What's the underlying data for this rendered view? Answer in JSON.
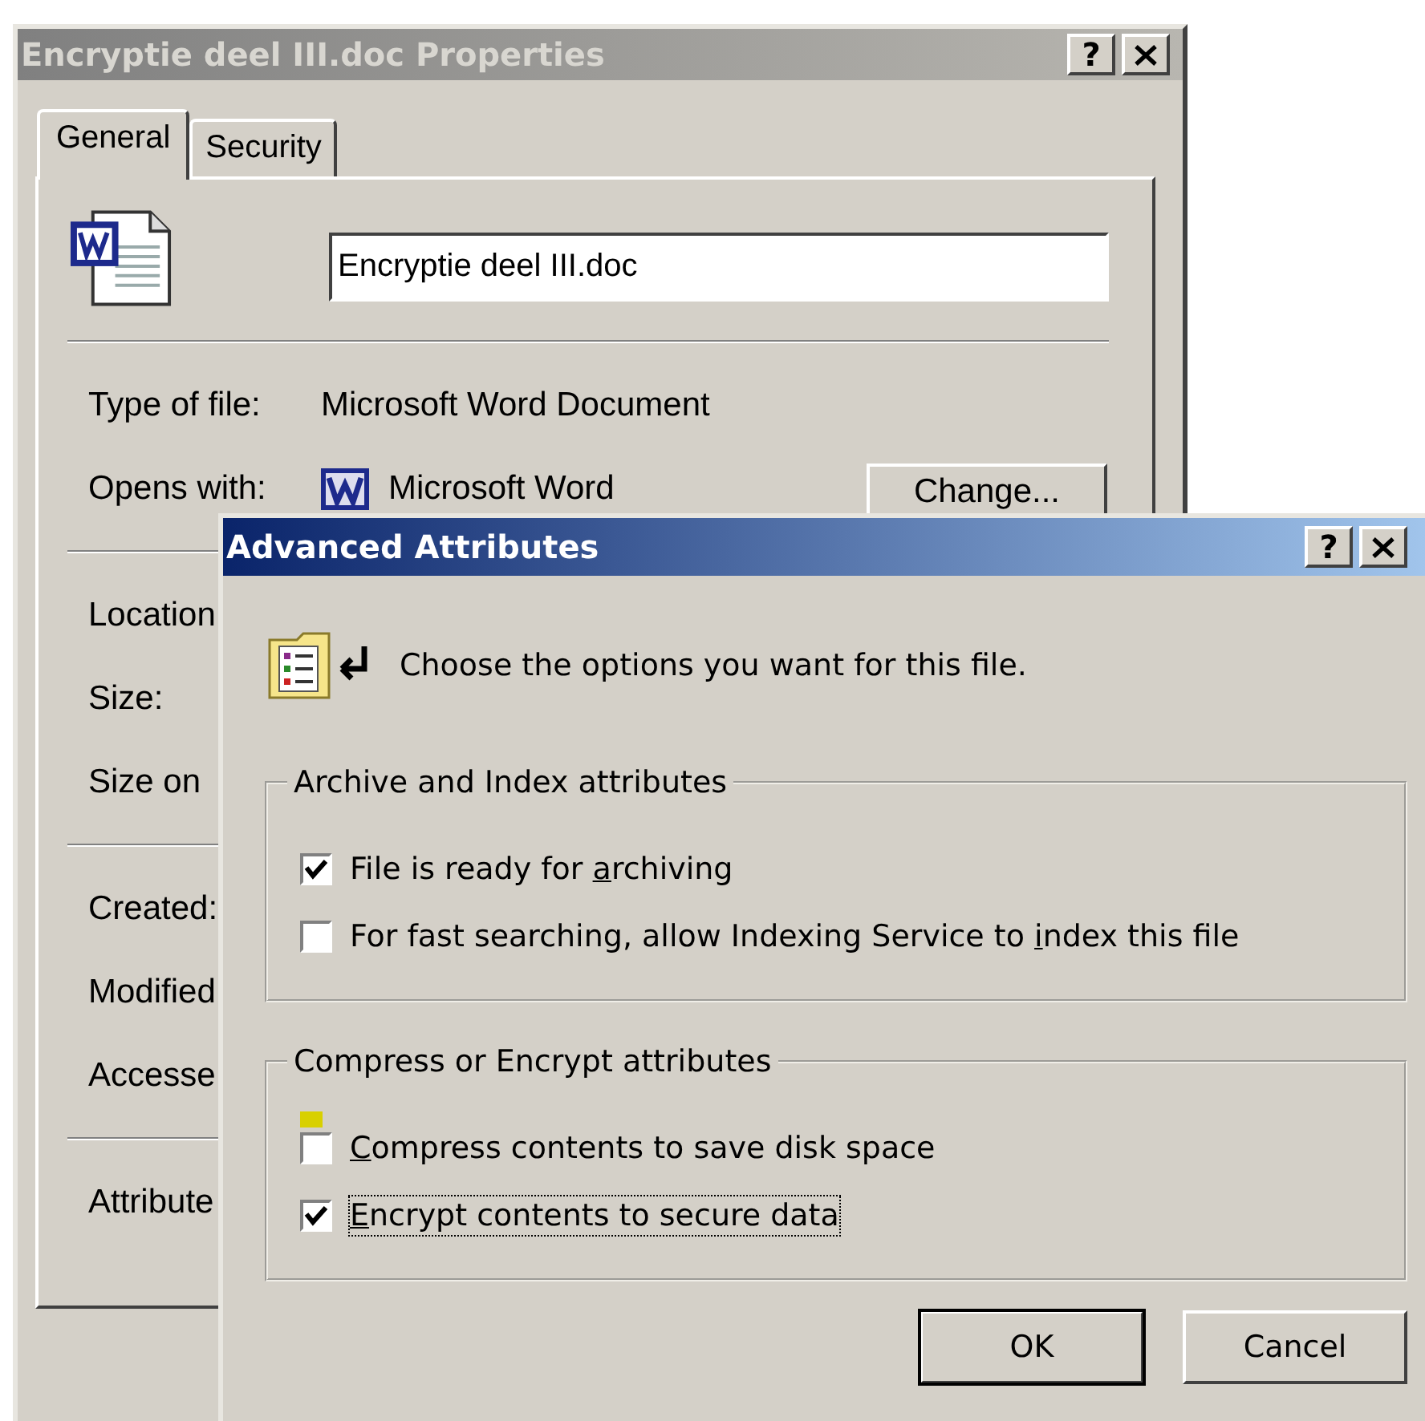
{
  "properties_window": {
    "title": "Encryptie deel III.doc Properties",
    "active": false,
    "help_button": "?",
    "tabs": [
      {
        "label": "General",
        "selected": true
      },
      {
        "label": "Security",
        "selected": false
      }
    ],
    "file_name": "Encryptie deel III.doc",
    "sections": [
      [
        {
          "kind": "info",
          "label": "Type of file:",
          "value": "Microsoft Word Document"
        },
        {
          "kind": "app",
          "label": "Opens with:",
          "value": "Microsoft Word",
          "button": "Change..."
        }
      ],
      [
        {
          "kind": "info",
          "label": "Location"
        },
        {
          "kind": "info",
          "label": "Size:"
        },
        {
          "kind": "info",
          "label": "Size on"
        }
      ],
      [
        {
          "kind": "info",
          "label": "Created:"
        },
        {
          "kind": "info",
          "label": "Modified"
        },
        {
          "kind": "info",
          "label": "Accesse"
        }
      ],
      [
        {
          "kind": "info",
          "label": "Attribute"
        }
      ]
    ]
  },
  "advanced_dialog": {
    "title": "Advanced Attributes",
    "active": true,
    "help_button": "?",
    "intro": "Choose the options you want for this file.",
    "groups": [
      {
        "legend": "Archive and Index attributes",
        "options": [
          {
            "label_start": "File is ready for ",
            "access_key": "a",
            "label_end": "rchiving",
            "checked": true,
            "focused": false
          },
          {
            "label_start": "For fast searching, allow Indexing Service to ",
            "access_key": "i",
            "label_end": "ndex this file",
            "checked": false,
            "focused": false
          }
        ]
      },
      {
        "legend": "Compress or Encrypt attributes",
        "options": [
          {
            "access_key": "C",
            "label_end": "ompress contents to save disk space",
            "checked": false,
            "focused": false
          },
          {
            "access_key": "E",
            "label_end": "ncrypt contents to secure data",
            "checked": true,
            "focused": true
          }
        ]
      }
    ],
    "buttons": [
      {
        "label": "OK",
        "default": true
      },
      {
        "label": "Cancel",
        "default": false
      }
    ]
  }
}
